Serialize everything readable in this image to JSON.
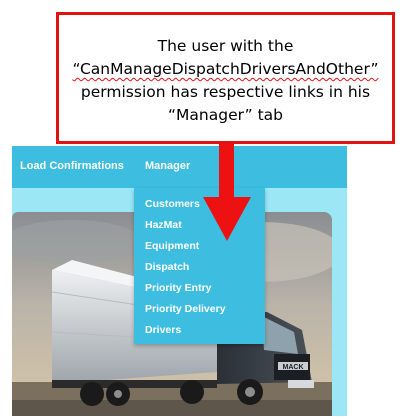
{
  "callout": {
    "line1": "The user with the",
    "line2": "“CanManageDispatchDriversAndOther”",
    "line3": "permission has respective links in his",
    "line4": "“Manager” tab"
  },
  "nav": {
    "items": [
      {
        "label": "Load Confirmations"
      },
      {
        "label": "Manager"
      }
    ]
  },
  "manager_menu": {
    "items": [
      {
        "label": "Customers"
      },
      {
        "label": "HazMat"
      },
      {
        "label": "Equipment"
      },
      {
        "label": "Dispatch"
      },
      {
        "label": "Priority Entry"
      },
      {
        "label": "Priority Delivery"
      },
      {
        "label": "Drivers"
      }
    ]
  },
  "truck": {
    "brand_badge": "MACK"
  },
  "colors": {
    "nav_bg": "#3dbde0",
    "content_bg": "#9be7f6",
    "annotation_red": "#e01212"
  }
}
